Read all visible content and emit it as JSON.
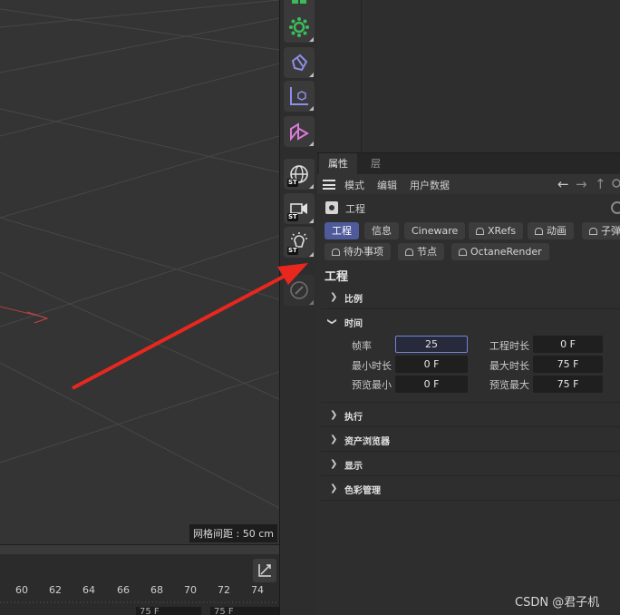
{
  "viewport": {
    "grid_readout": "网格间距 : 50 cm"
  },
  "timeline": {
    "ticks": [
      "60",
      "62",
      "64",
      "66",
      "68",
      "70",
      "72",
      "74"
    ],
    "field_a": "75 F",
    "field_b": "75 F"
  },
  "tools": [
    {
      "name": "green-cube-icon",
      "color": "#3dbb5a"
    },
    {
      "name": "gear-generator-icon",
      "color": "#3dbb5a"
    },
    {
      "name": "deformer-icon",
      "color": "#8d8ee6"
    },
    {
      "name": "axis-cube-icon",
      "color": "#8d8ee6"
    },
    {
      "name": "spline-icon",
      "color": "#d97bd6"
    },
    {
      "name": "globe-st-icon",
      "color": "#e0e0e0"
    },
    {
      "name": "camera-st-icon",
      "color": "#e0e0e0"
    },
    {
      "name": "light-st-icon",
      "color": "#e0e0e0"
    },
    {
      "name": "pen-disabled-icon",
      "color": "#6e6e6e"
    }
  ],
  "attr": {
    "tabs": [
      "属性",
      "层"
    ],
    "menu": [
      "模式",
      "编辑",
      "用户数据"
    ],
    "object_name": "工程",
    "pills_row1": [
      "工程",
      "信息",
      "Cineware",
      "XRefs",
      "动画",
      "子弹"
    ],
    "pills_row2": [
      "待办事项",
      "节点",
      "OctaneRender"
    ],
    "section_title": "工程",
    "groups_collapsed_top": [
      "比例"
    ],
    "group_open": "时间",
    "fields": {
      "fps_label": "帧率",
      "fps_value": "25",
      "project_time_label": "工程时长",
      "project_time_value": "0 F",
      "min_time_label": "最小时长",
      "min_time_value": "0 F",
      "max_time_label": "最大时长",
      "max_time_value": "75 F",
      "preview_min_label": "预览最小",
      "preview_min_value": "0 F",
      "preview_max_label": "预览最大",
      "preview_max_value": "75 F"
    },
    "groups_collapsed_bottom": [
      "执行",
      "资产浏览器",
      "显示",
      "色彩管理"
    ]
  },
  "watermark": "CSDN @君子机",
  "colors": {
    "accent": "#4f5a9a",
    "arrow": "#e8271f"
  }
}
